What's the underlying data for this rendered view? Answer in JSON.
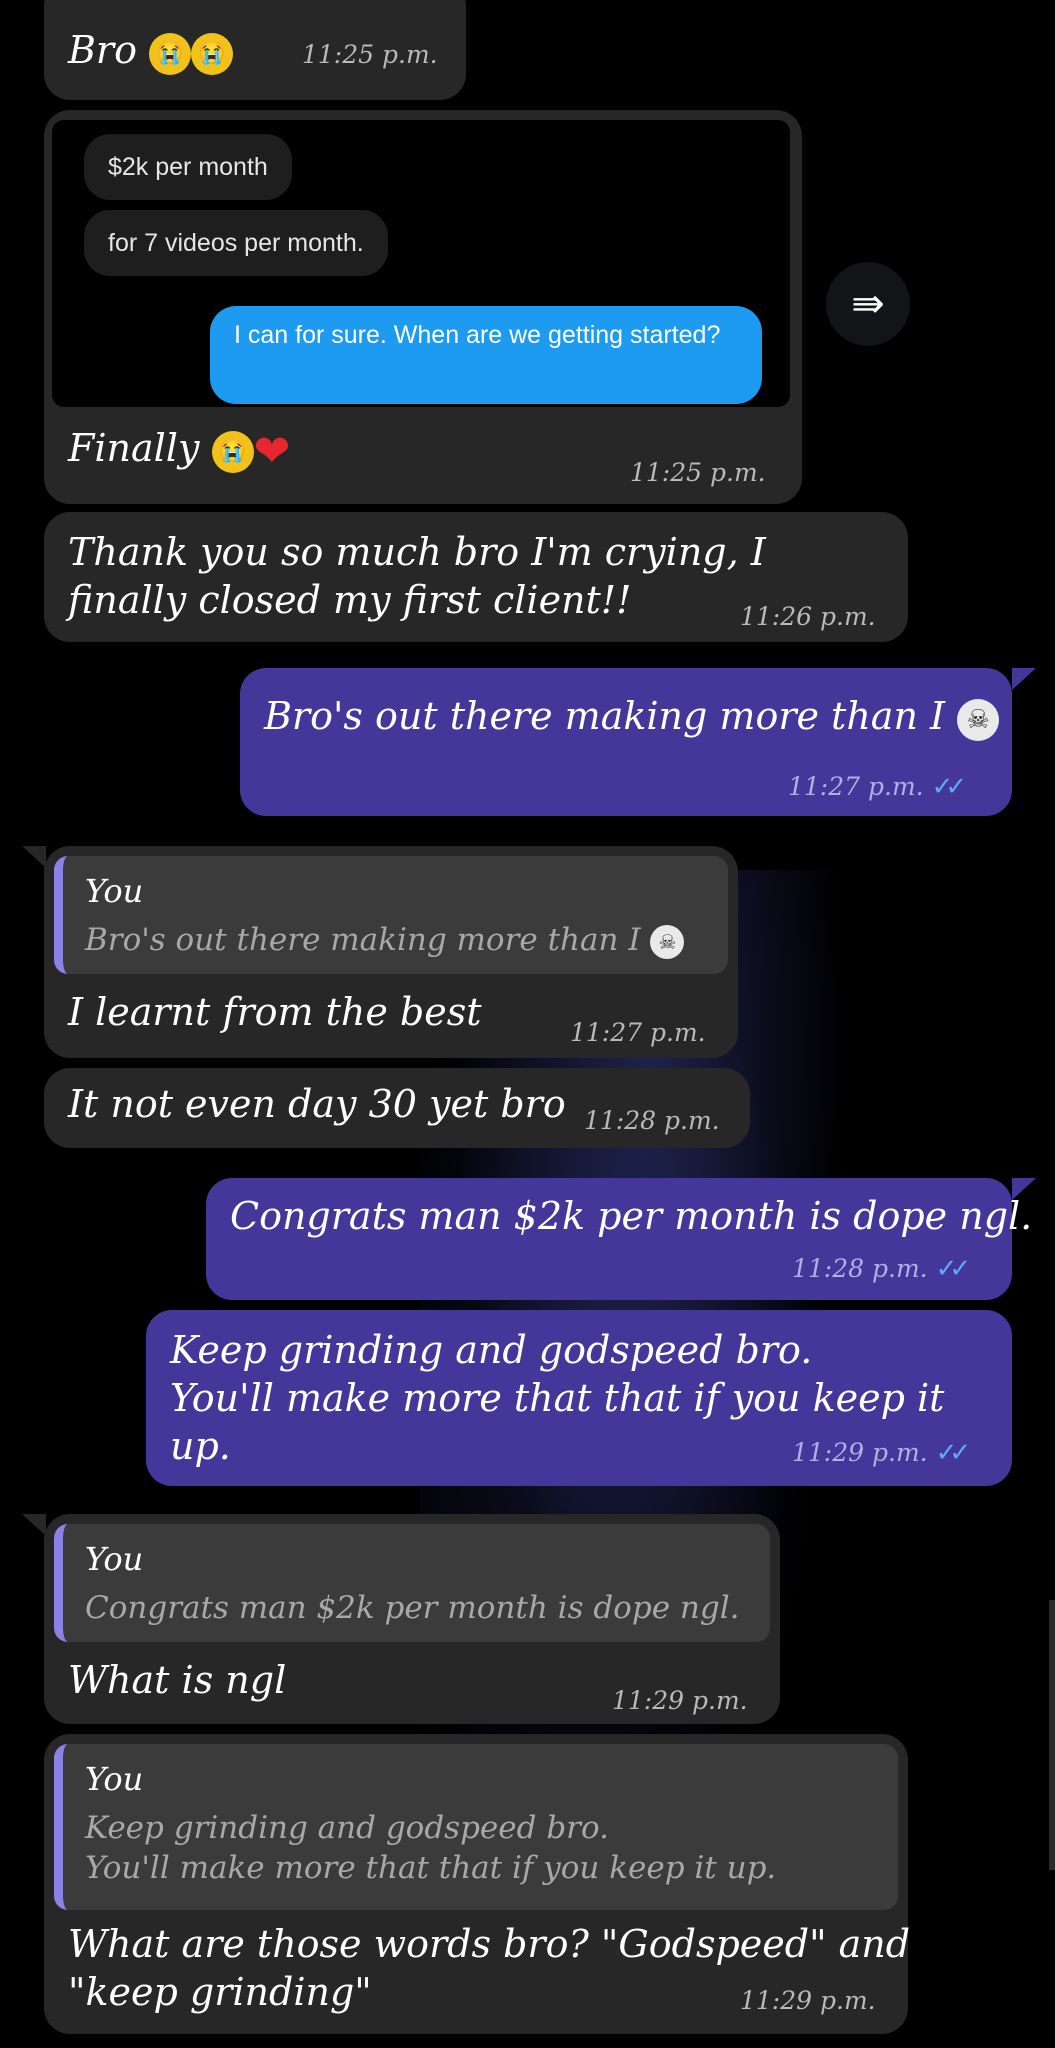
{
  "messages": {
    "m1": {
      "text": "Bro",
      "time": "11:25 p.m."
    },
    "m2": {
      "screenshot": {
        "pill1": "$2k per month",
        "pill2": "for 7 videos per month.",
        "reply": "I can for sure. When are we getting started?"
      },
      "text": "Finally",
      "time": "11:25 p.m."
    },
    "m3": {
      "text": "Thank you so much bro I'm crying, I finally closed my first client!!",
      "time": "11:26 p.m."
    },
    "m4": {
      "text": "Bro's out there making more than I",
      "time": "11:27 p.m."
    },
    "m5": {
      "reply_name": "You",
      "reply_text": "Bro's out there making more than I",
      "text": "I learnt from the best",
      "time": "11:27 p.m."
    },
    "m6": {
      "text": "It not even day 30 yet bro",
      "time": "11:28 p.m."
    },
    "m7": {
      "text": "Congrats man $2k per month is dope ngl.",
      "time": "11:28 p.m."
    },
    "m8": {
      "line1": "Keep grinding and godspeed bro.",
      "line2": "You'll make more that that if you keep it",
      "line3": "up.",
      "time": "11:29 p.m."
    },
    "m9": {
      "reply_name": "You",
      "reply_text": "Congrats man $2k per month is dope ngl.",
      "text": "What is ngl",
      "time": "11:29 p.m."
    },
    "m10": {
      "reply_name": "You",
      "reply_line1": "Keep grinding and godspeed bro.",
      "reply_line2": "You'll make more that that if you keep it up.",
      "line1": "What are those words bro? \"Godspeed\" and",
      "line2": "\"keep grinding\"",
      "time": "11:29 p.m."
    }
  },
  "icons": {
    "forward": "forward-share-icon",
    "read_receipt": "double-check-icon"
  },
  "colors": {
    "incoming": "#272727",
    "outgoing": "#453699",
    "reply_accent": "#8c82e6",
    "check": "#5aa8ff"
  }
}
